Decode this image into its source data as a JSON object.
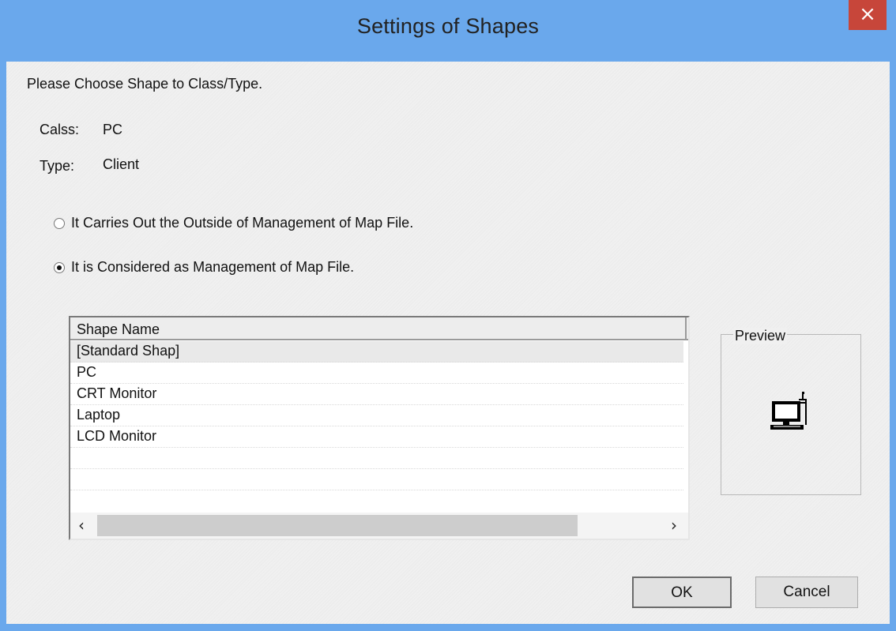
{
  "window": {
    "title": "Settings of Shapes",
    "close_glyph": "×"
  },
  "prompt": "Please Choose Shape to Class/Type.",
  "class_row": {
    "label": "Calss:",
    "value": "PC"
  },
  "type_row": {
    "label": "Type:",
    "value": "Client"
  },
  "options": [
    {
      "label": "It Carries Out the Outside of Management of Map File.",
      "selected": false
    },
    {
      "label": "It is Considered as Management of Map File.",
      "selected": true
    }
  ],
  "shape_list": {
    "column_header": "Shape Name",
    "items": [
      "[Standard Shap]",
      "PC",
      "CRT Monitor",
      "Laptop",
      "LCD Monitor"
    ],
    "selected_index": 0,
    "scroll_left_glyph": "‹",
    "scroll_right_glyph": "›"
  },
  "preview": {
    "label": "Preview",
    "icon": "computer-icon"
  },
  "buttons": {
    "ok": "OK",
    "cancel": "Cancel"
  },
  "colors": {
    "title_bar": "#6aa8ec",
    "close_button": "#c7463a",
    "dialog_face": "#f0f0f0"
  }
}
